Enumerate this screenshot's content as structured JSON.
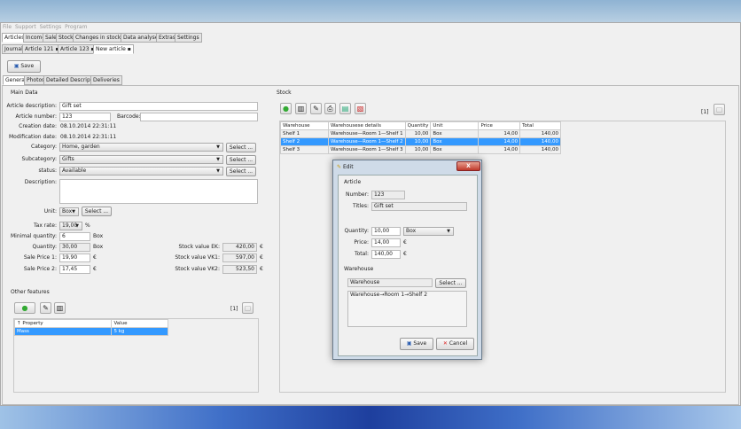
{
  "menu": [
    "File",
    "Support",
    "Settings",
    "Program"
  ],
  "main_tabs": [
    "Articles",
    "Income",
    "Sale",
    "Stock",
    "Changes in stocking",
    "Data analyses",
    "Extras",
    "Settings"
  ],
  "doc_tabs": [
    "Journal",
    "Article 121",
    "Article 123",
    "New article"
  ],
  "toolbar": {
    "save": "Save"
  },
  "sub_tabs": [
    "General",
    "Photos",
    "Detailed Description",
    "Deliveries"
  ],
  "main_data": {
    "title": "Main Data",
    "article_description_label": "Article description:",
    "article_description": "Gift set",
    "article_number_label": "Article number:",
    "article_number": "123",
    "barcode_label": "Barcode:",
    "barcode": "",
    "creation_label": "Creation date:",
    "creation": "08.10.2014  22:31:11",
    "modification_label": "Modification date:",
    "modification": "08.10.2014  22:31:11",
    "category_label": "Category:",
    "category": "Home, garden",
    "subcategory_label": "Subcategory:",
    "subcategory": "Gifts",
    "status_label": "status:",
    "status": "Available",
    "select": "Select ...",
    "description_label": "Description:",
    "unit_label": "Unit:",
    "unit": "Box",
    "tax_label": "Tax rate:",
    "tax": "19,00",
    "percent": "%",
    "min_qty_label": "Minimal quantity:",
    "min_qty": "6",
    "min_qty_unit": "Box",
    "qty_label": "Quantity:",
    "qty": "30,00",
    "qty_unit": "Box",
    "sp1_label": "Sale Price 1:",
    "sp1": "19,90",
    "sp2_label": "Sale Price 2:",
    "sp2": "17,45",
    "euro": "€",
    "ek_label": "Stock value EK:",
    "ek": "420,00",
    "vk1_label": "Stock value VK1:",
    "vk1": "597,00",
    "vk2_label": "Stock value VK2:",
    "vk2": "523,50"
  },
  "other": {
    "title": "Other features",
    "count": "[1]",
    "headers": [
      "↑ Property",
      "Value"
    ],
    "rows": [
      [
        "Mass",
        "5 kg"
      ]
    ]
  },
  "stock": {
    "title": "Stock",
    "count": "[1]",
    "headers": [
      "Warehouse",
      "Warehousese details",
      "Quantity",
      "Unit",
      "Price",
      "Total"
    ],
    "rows": [
      [
        "Shelf 1",
        "Warehouse—Room 1—Shelf 1",
        "10,00",
        "Box",
        "14,00",
        "140,00"
      ],
      [
        "Shelf 2",
        "Warehouse—Room 1—Shelf 2",
        "10,00",
        "Box",
        "14,00",
        "140,00"
      ],
      [
        "Shelf 3",
        "Warehouse—Room 1—Shelf 3",
        "10,00",
        "Box",
        "14,00",
        "140,00"
      ]
    ]
  },
  "dialog": {
    "title": "Edit",
    "article": "Article",
    "number_label": "Number:",
    "number": "123",
    "titles_label": "Titles:",
    "titles": "Gift set",
    "qty_label": "Quantity:",
    "qty": "10,00",
    "unit": "Box",
    "price_label": "Price:",
    "price": "14,00",
    "total_label": "Total:",
    "total": "140,00",
    "euro": "€",
    "warehouse_group": "Warehouse",
    "warehouse": "Warehouse",
    "select": "Select ...",
    "path": "Warehouse→Room 1→Shelf 2",
    "save": "Save",
    "cancel": "Cancel"
  }
}
